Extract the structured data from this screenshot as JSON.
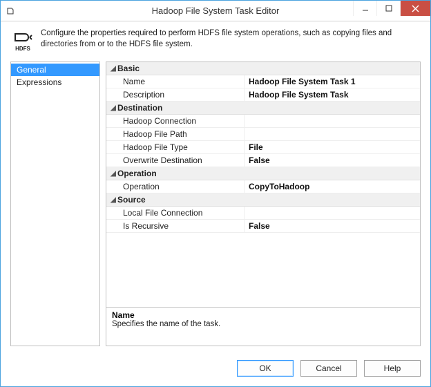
{
  "titlebar": {
    "title": "Hadoop File System Task Editor",
    "icon_label": "HDFS"
  },
  "header": {
    "icon_label": "HDFS",
    "description": "Configure the properties required to perform HDFS file system operations, such as copying files and directories from or to the HDFS file system."
  },
  "nav": {
    "items": [
      {
        "label": "General",
        "selected": true
      },
      {
        "label": "Expressions",
        "selected": false
      }
    ]
  },
  "properties": {
    "categories": [
      {
        "name": "Basic",
        "rows": [
          {
            "label": "Name",
            "value": "Hadoop File System Task 1"
          },
          {
            "label": "Description",
            "value": "Hadoop File System Task"
          }
        ]
      },
      {
        "name": "Destination",
        "rows": [
          {
            "label": "Hadoop Connection",
            "value": ""
          },
          {
            "label": "Hadoop File Path",
            "value": ""
          },
          {
            "label": "Hadoop File Type",
            "value": "File"
          },
          {
            "label": "Overwrite Destination",
            "value": "False"
          }
        ]
      },
      {
        "name": "Operation",
        "rows": [
          {
            "label": "Operation",
            "value": "CopyToHadoop"
          }
        ]
      },
      {
        "name": "Source",
        "rows": [
          {
            "label": "Local File Connection",
            "value": ""
          },
          {
            "label": "Is Recursive",
            "value": "False"
          }
        ]
      }
    ]
  },
  "description_panel": {
    "title": "Name",
    "text": "Specifies the name of the task."
  },
  "footer": {
    "ok": "OK",
    "cancel": "Cancel",
    "help": "Help"
  }
}
